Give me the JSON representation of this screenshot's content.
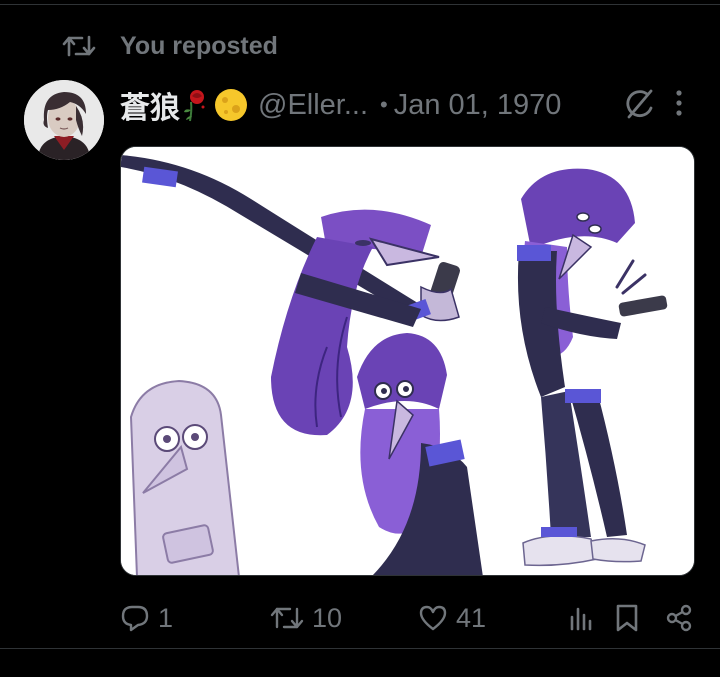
{
  "social_context": {
    "text": "You reposted",
    "icon": "repost-icon"
  },
  "post": {
    "author_name": "蒼狼",
    "author_emoji": [
      "rose-icon",
      "moon-icon"
    ],
    "handle": "@Eller...",
    "separator": "•",
    "date": "Jan 01, 1970",
    "media_description_icon": "grok-icon",
    "more_icon": "more-icon"
  },
  "actions": {
    "reply_count": "1",
    "repost_count": "10",
    "like_count": "41"
  },
  "colors": {
    "background": "#000000",
    "text_primary": "#e7e9ea",
    "text_secondary": "#71767b",
    "border": "#2f3336"
  }
}
